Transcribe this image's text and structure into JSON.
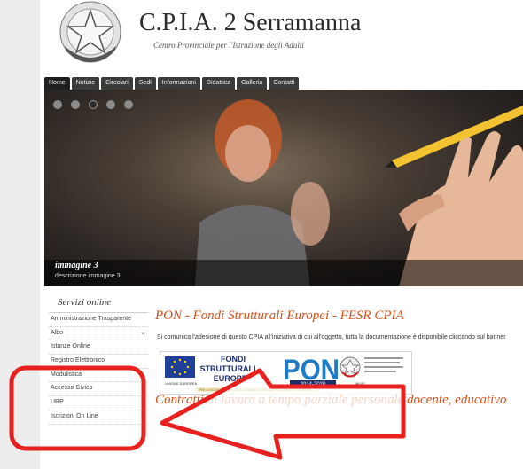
{
  "header": {
    "title": "C.P.I.A. 2 Serramanna",
    "subtitle": "Centro Provinciale per l'Istruzione degli Adulti",
    "logo_text": "REPUBBLICA ITALIANA"
  },
  "nav": {
    "tabs": [
      {
        "label": "Home",
        "active": true
      },
      {
        "label": "Notizie"
      },
      {
        "label": "Circolari"
      },
      {
        "label": "Sedi"
      },
      {
        "label": "Informazioni"
      },
      {
        "label": "Didattica"
      },
      {
        "label": "Galleria"
      },
      {
        "label": "Contatti"
      }
    ]
  },
  "slider": {
    "dot_count": 5,
    "active_dot": 3,
    "caption_title": "immagine 3",
    "caption_desc": "descrizione immagine 3"
  },
  "sidebar": {
    "title": "Servizi online",
    "items": [
      {
        "label": "Amministrazione Trasparente"
      },
      {
        "label": "Albo",
        "has_submenu": true
      },
      {
        "label": "Istanze Online"
      },
      {
        "label": "Registro Elettronico"
      },
      {
        "label": "Modulistica"
      },
      {
        "label": "Accesso Civico"
      },
      {
        "label": "URP"
      },
      {
        "label": "Iscrizioni On Line"
      }
    ]
  },
  "main": {
    "news_title": "PON - Fondi Strutturali Europei - FESR CPIA",
    "news_text": "Si comunica l'adesione di questo CPIA all'iniziativa di cui all'oggetto, tutta la documentazione è disponibile cliccando sul banner",
    "banner": {
      "fondi_line1": "FONDI",
      "fondi_line2": "STRUTTURALI",
      "fondi_line3": "EUROPEI",
      "pon": "PON",
      "years": "2014-2020",
      "eu_label": "UNIONE EUROPEA",
      "footer": "PER LA SCUOLA - COMPETENZE E AMBIENTI PER L'APPRENDIMENTO (FSE-FESR)",
      "miur_label": "MIUR"
    },
    "news_title2": "Contratti di lavoro a tempo parziale personale docente, educativo"
  },
  "annotation": {
    "box_color": "#e8201e",
    "arrow_color": "#e8201e"
  }
}
